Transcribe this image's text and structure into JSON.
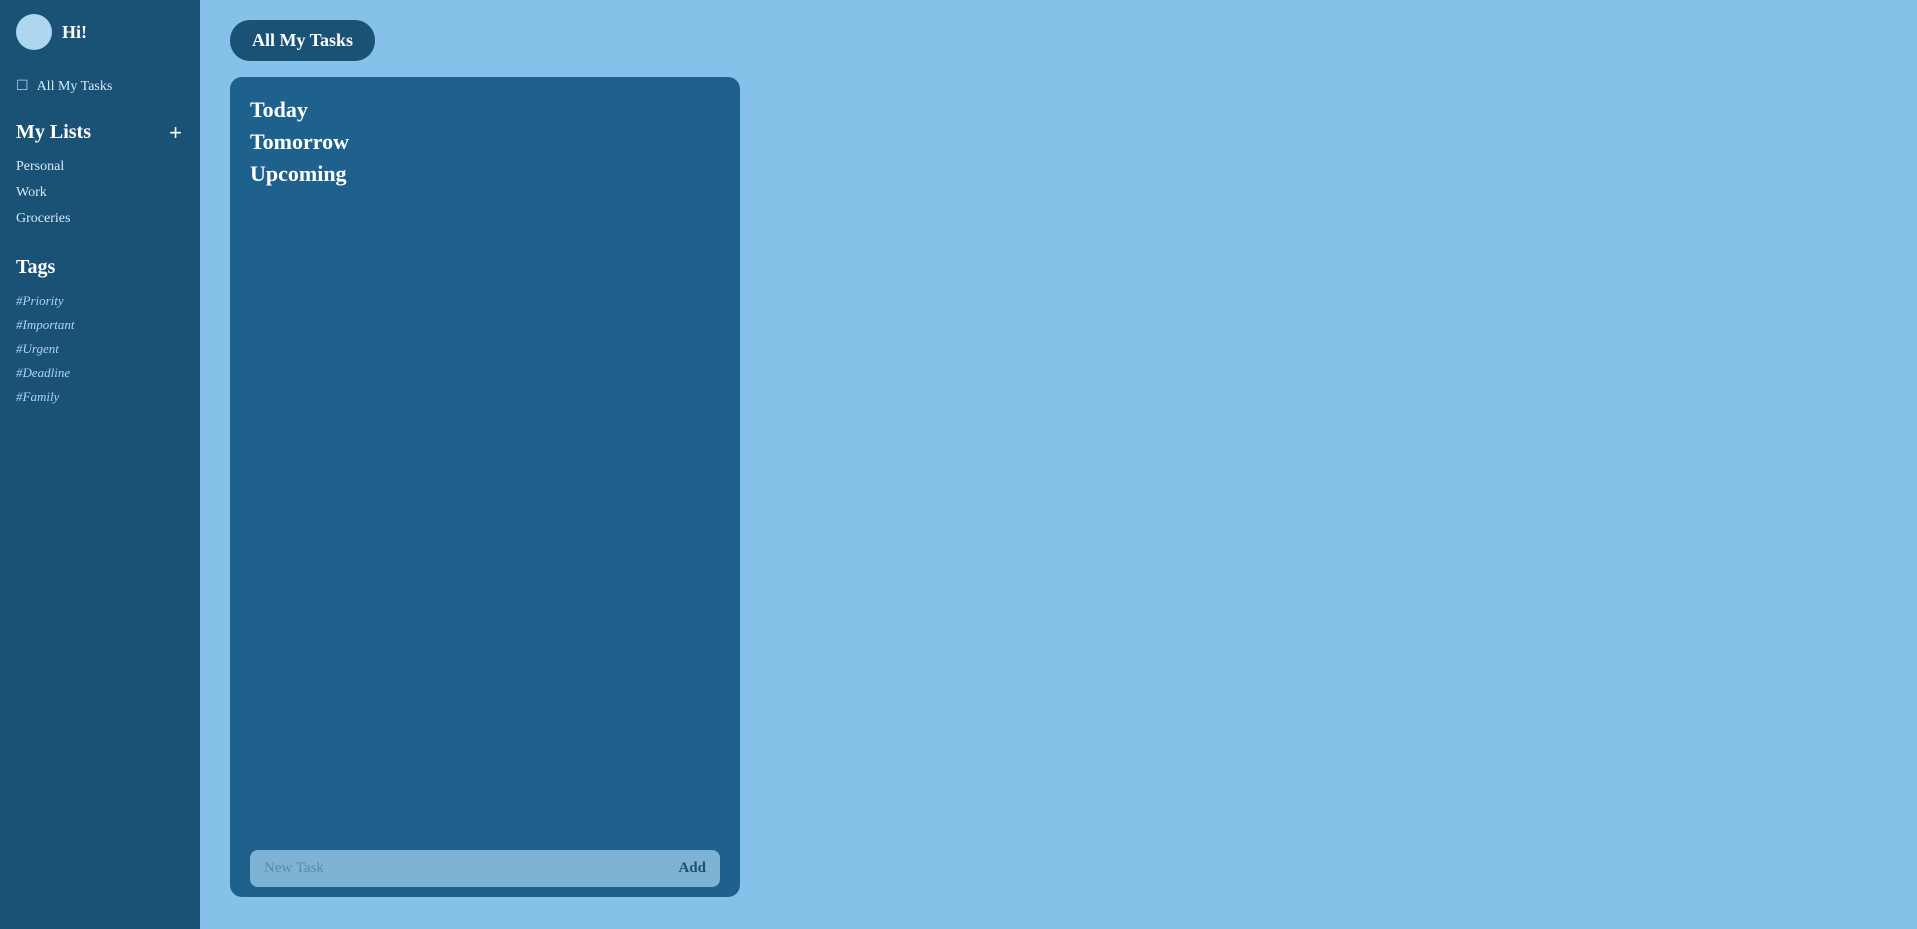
{
  "sidebar": {
    "user": {
      "greeting": "Hi!"
    },
    "all_tasks_label": "All My Tasks",
    "my_lists_section": {
      "title": "My Lists",
      "add_button_label": "+",
      "lists": [
        {
          "name": "Personal"
        },
        {
          "name": "Work"
        },
        {
          "name": "Groceries"
        }
      ]
    },
    "tags_section": {
      "title": "Tags",
      "tags": [
        {
          "name": "#Priority"
        },
        {
          "name": "#Important"
        },
        {
          "name": "#Urgent"
        },
        {
          "name": "#Deadline"
        },
        {
          "name": "#Family"
        }
      ]
    }
  },
  "main": {
    "page_title": "All My Tasks",
    "task_card": {
      "filters": [
        {
          "label": "Today"
        },
        {
          "label": "Tomorrow"
        },
        {
          "label": "Upcoming"
        }
      ],
      "new_task_placeholder": "New Task",
      "add_button_label": "Add"
    }
  }
}
